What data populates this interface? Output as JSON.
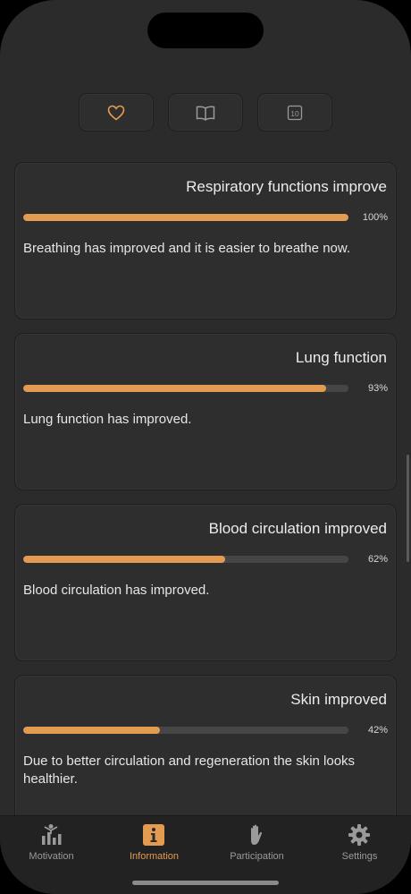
{
  "segments": [
    {
      "icon": "heart-icon",
      "selected": true
    },
    {
      "icon": "book-icon",
      "selected": false
    },
    {
      "icon": "calendar-10-icon",
      "selected": false,
      "badge": "10"
    }
  ],
  "cards": [
    {
      "title": "Respiratory functions improve",
      "progress": 100,
      "percent_label": "100%",
      "description": "Breathing has improved and it is easier to breathe now."
    },
    {
      "title": "Lung function",
      "progress": 93,
      "percent_label": "93%",
      "description": "Lung function has improved."
    },
    {
      "title": "Blood circulation improved",
      "progress": 62,
      "percent_label": "62%",
      "description": "Blood circulation has improved."
    },
    {
      "title": "Skin improved",
      "progress": 42,
      "percent_label": "42%",
      "description": "Due to better circulation and regeneration the skin looks healthier."
    }
  ],
  "tabbar": {
    "items": [
      {
        "label": "Motivation",
        "icon": "chart-person-icon",
        "active": false
      },
      {
        "label": "Information",
        "icon": "info-icon",
        "active": true
      },
      {
        "label": "Participation",
        "icon": "hand-icon",
        "active": false
      },
      {
        "label": "Settings",
        "icon": "gear-icon",
        "active": false
      }
    ]
  },
  "colors": {
    "accent": "#e39b52",
    "background": "#2b2b2b",
    "card": "#2e2e2e",
    "track": "#464646"
  }
}
